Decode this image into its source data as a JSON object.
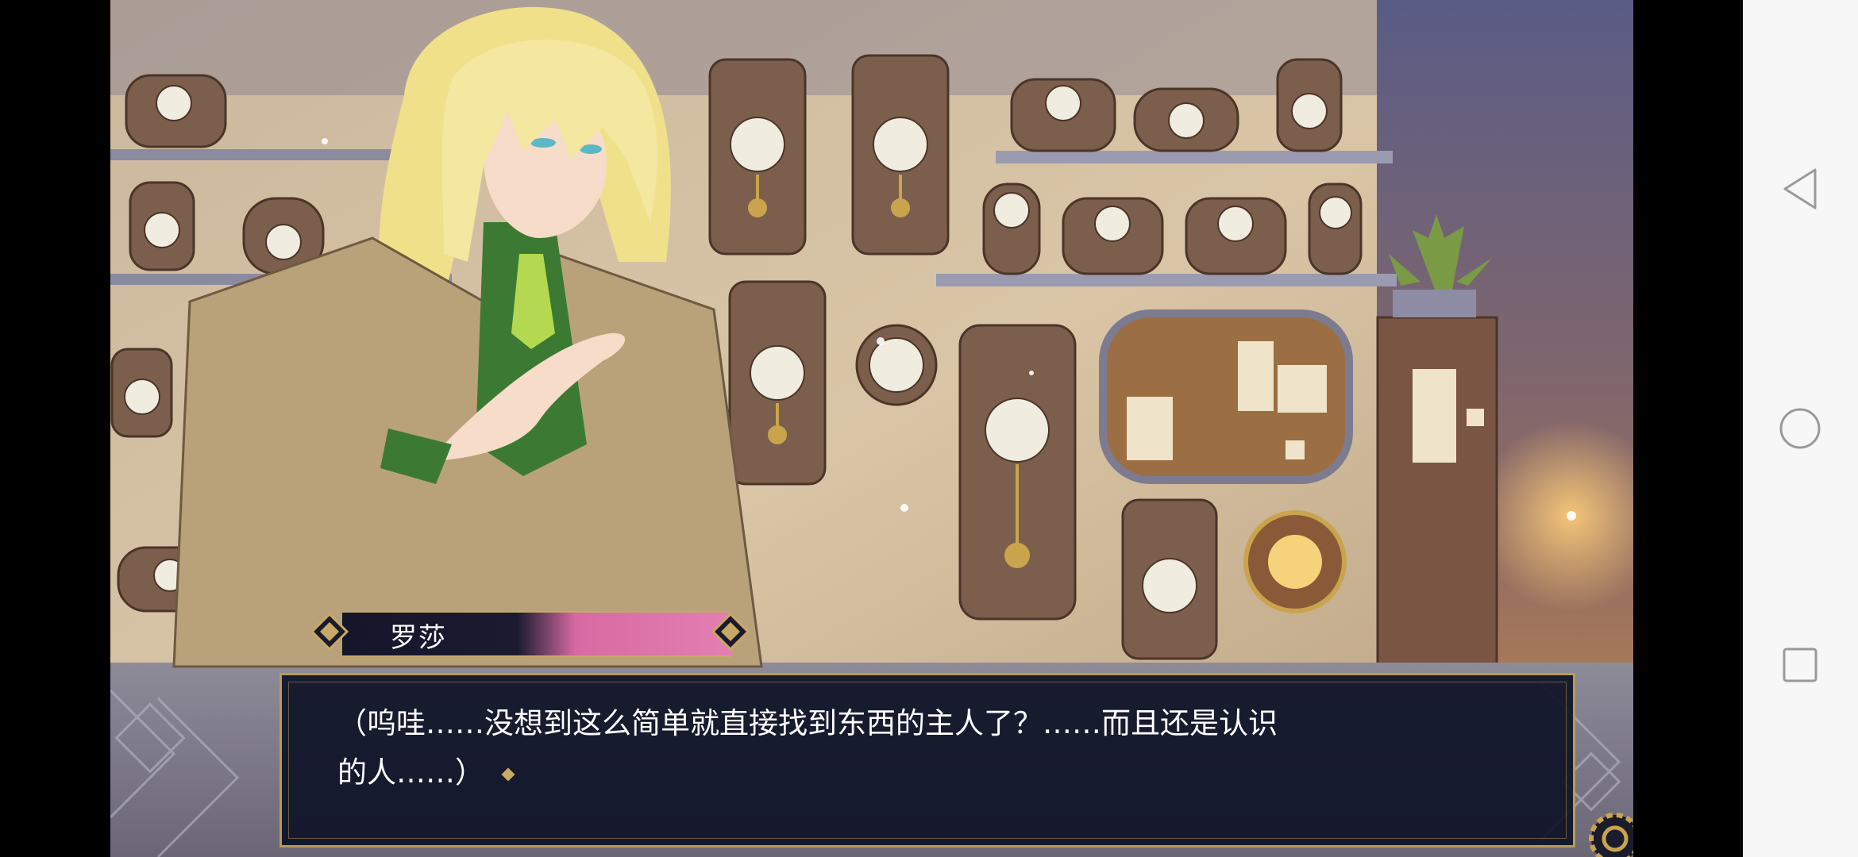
{
  "dialogue": {
    "speaker": "罗莎",
    "line1": "（呜哇……没想到这么简单就直接找到东西的主人了？……而且还是认识",
    "line2": "的人……）"
  },
  "icons": {
    "back": "triangle-back-icon",
    "home": "circle-home-icon",
    "recents": "square-recents-icon",
    "settings": "gear-icon",
    "advance": "diamond-advance-icon"
  },
  "colors": {
    "dialog_bg": "#0e1226",
    "gold_border": "#b99a57",
    "name_plate_pink": "#e37fb2",
    "navbar_bg": "#f7f7f7"
  }
}
